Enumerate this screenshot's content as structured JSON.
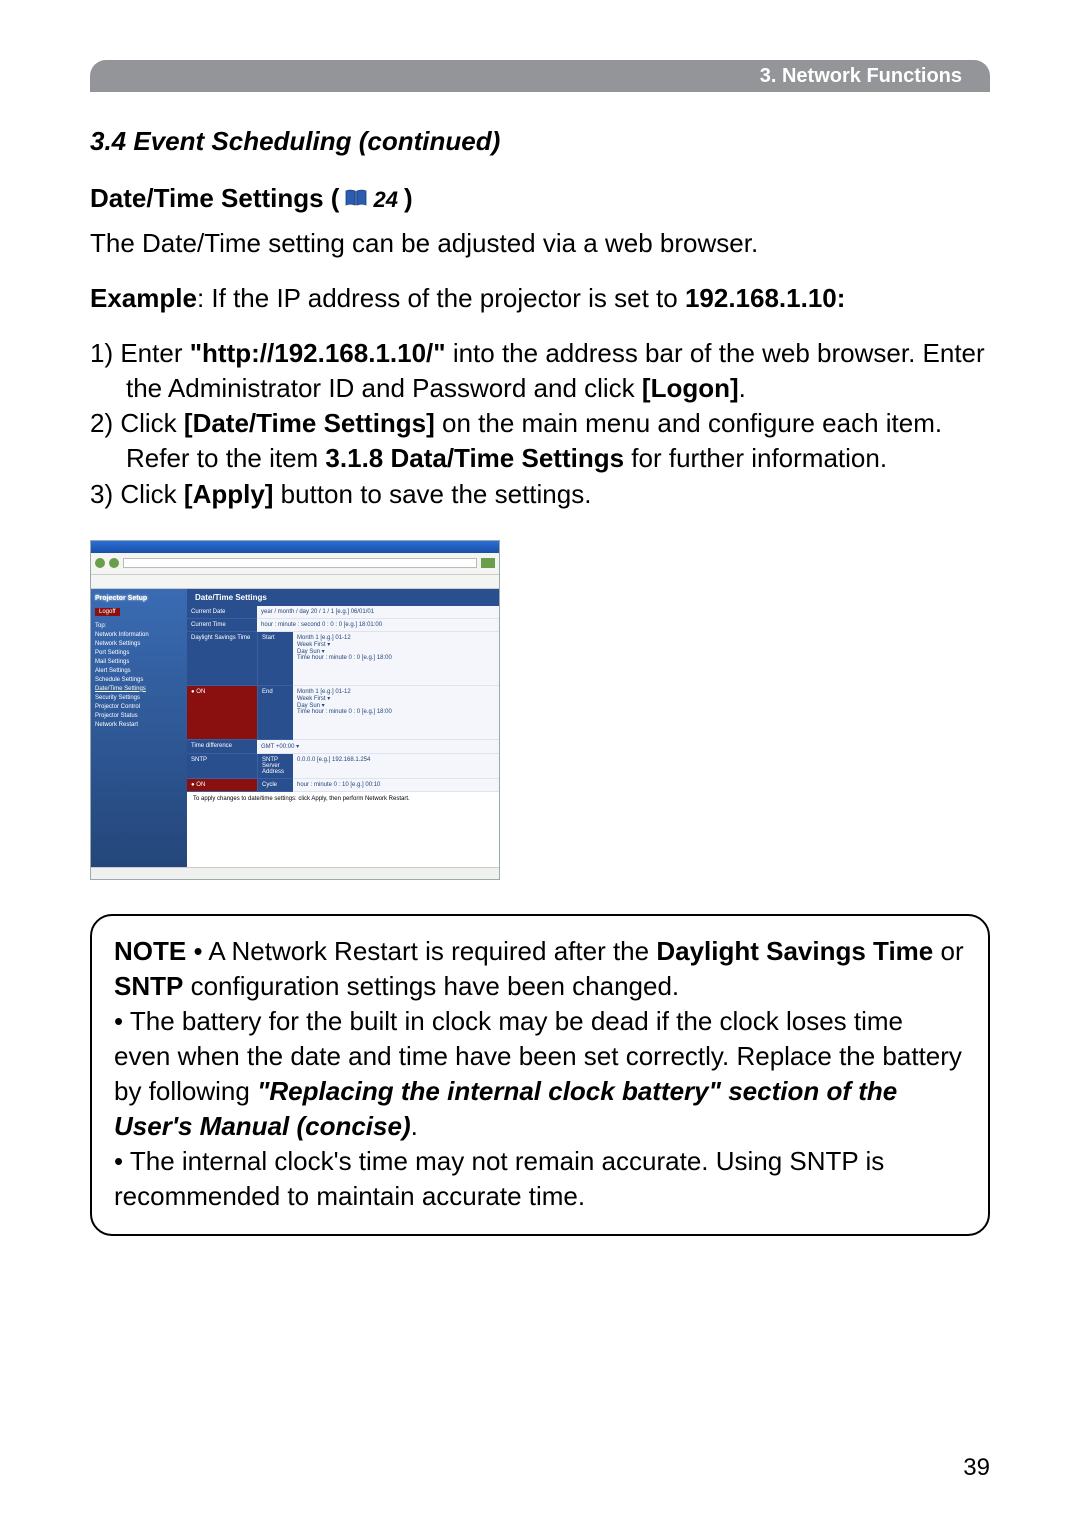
{
  "header": {
    "chapter": "3. Network Functions"
  },
  "section": {
    "title": "3.4 Event Scheduling (continued)"
  },
  "subsection": {
    "title_prefix": "Date/Time Settings (",
    "page_ref": "24",
    "title_suffix": ")"
  },
  "intro": "The Date/Time setting can be adjusted via a web browser.",
  "example": {
    "label": "Example",
    "text_before_ip": ": If the IP address of the projector is set to ",
    "ip": "192.168.1.10:"
  },
  "steps": {
    "s1_a": "1) Enter ",
    "s1_url": "\"http://192.168.1.10/\"",
    "s1_b": " into the address bar of the web browser. Enter the Administrator ID and Password and click ",
    "s1_btn": "[Logon]",
    "s1_c": ".",
    "s2_a": "2) Click ",
    "s2_btn": "[Date/Time Settings]",
    "s2_b": " on the main menu and configure each item. Refer to the item ",
    "s2_ref": "3.1.8 Data/Time Settings",
    "s2_c": " for further information.",
    "s3_a": "3) Click ",
    "s3_btn": "[Apply]",
    "s3_b": " button to save the settings."
  },
  "screenshot": {
    "setup_title": "Projector Setup",
    "logoff": "Logoff",
    "side_items": [
      "Top:",
      "Network Information",
      "Network Settings",
      "Port Settings",
      "Mail Settings",
      "Alert Settings",
      "Schedule Settings",
      "Date/Time Settings",
      "Security Settings",
      "Projector Control",
      "Projector Status",
      "Network Restart"
    ],
    "main_header": "Date/Time Settings",
    "rows": {
      "current_date_label": "Current Date",
      "current_date_val": "year / month / day  20  /  1  /  1    [e.g.] 06/01/01",
      "current_time_label": "Current Time",
      "current_time_val": "hour : minute : second  0  :  0  :  0    [e.g.] 18:01:00",
      "daylight_label": "Daylight Savings Time",
      "start_label": "Start",
      "start_month": "Month  1    [e.g.] 01-12",
      "start_week": "Week  First ▾",
      "start_day": "Day  Sun ▾",
      "start_time": "Time hour : minute  0  :  0    [e.g.] 18:00",
      "end_label": "End",
      "end_month": "Month  1    [e.g.] 01-12",
      "end_week": "Week  First ▾",
      "end_day": "Day  Sun ▾",
      "end_time": "Time hour : minute  0  :  0    [e.g.] 18:00",
      "tz_label": "Time difference",
      "tz_val": "GMT  +00:00 ▾",
      "sntp_label": "SNTP",
      "sntp_addr_label": "SNTP Server Address",
      "sntp_addr_val": "0.0.0.0                                  [e.g.] 192.168.1.254",
      "sntp_cycle_label": "Cycle",
      "sntp_cycle_val": "hour : minute  0  :  10    [e.g.] 00:10",
      "apply_note": "To apply changes to date/time settings: click Apply, then perform Network Restart."
    }
  },
  "note": {
    "label": "NOTE",
    "bullet1_a": "  • A Network Restart is required after the ",
    "bullet1_b": "Daylight Savings Time",
    "bullet1_c": " or ",
    "bullet1_d": "SNTP",
    "bullet1_e": " configuration settings have been changed.",
    "bullet2_a": "• The battery for the built in clock may be dead if the clock loses time even when the date and time have been set correctly. Replace the battery by following ",
    "bullet2_b": "\"Replacing the internal clock battery\" section of the User's Manual (concise)",
    "bullet2_c": ".",
    "bullet3": "• The internal clock's time may not remain accurate. Using SNTP is recommended to maintain accurate time."
  },
  "page_number": "39"
}
